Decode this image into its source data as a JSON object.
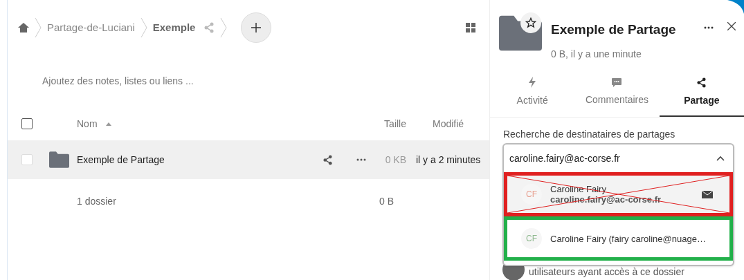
{
  "breadcrumb": {
    "items": [
      {
        "label": "Partage-de-Luciani",
        "current": false
      },
      {
        "label": "Exemple",
        "current": true
      }
    ]
  },
  "notes_placeholder": "Ajoutez des notes, listes ou liens ...",
  "table": {
    "all_checked": false,
    "columns": [
      {
        "label": "Nom",
        "sorted": true
      },
      {
        "label": "Taille",
        "sorted": false
      },
      {
        "label": "Modifié",
        "sorted": false
      }
    ],
    "rows": [
      {
        "name": "Exemple de Partage",
        "size": "0 KB",
        "modified": "il y a 2 minutes",
        "checked": false,
        "selected": true
      }
    ],
    "summary": {
      "count": "1 dossier",
      "size": "0 B"
    }
  },
  "sidebar": {
    "title": "Exemple de Partage",
    "subtitle": "0 B, il y a une minute",
    "favorite": false,
    "tabs": [
      {
        "label": "Activité",
        "kind": "activity",
        "selected": false
      },
      {
        "label": "Commentaires",
        "kind": "comments",
        "selected": false
      },
      {
        "label": "Partage",
        "kind": "share",
        "selected": true
      }
    ],
    "search": {
      "label": "Recherche de destinataires de partages",
      "value": "caroline.fairy@ac-corse.fr"
    },
    "suggestions": [
      {
        "kind": "email",
        "initials": "CF",
        "name": "Caroline Fairy",
        "detail": "caroline.fairy@ac-corse.fr",
        "color": "#e8a090",
        "crossed_out": true
      },
      {
        "kind": "user",
        "initials": "CF",
        "name": "Caroline Fairy (fairy caroline@nuage…",
        "color": "#8fb98f",
        "crossed_out": false
      }
    ],
    "footer_text": "utilisateurs ayant accès à ce dossier"
  }
}
